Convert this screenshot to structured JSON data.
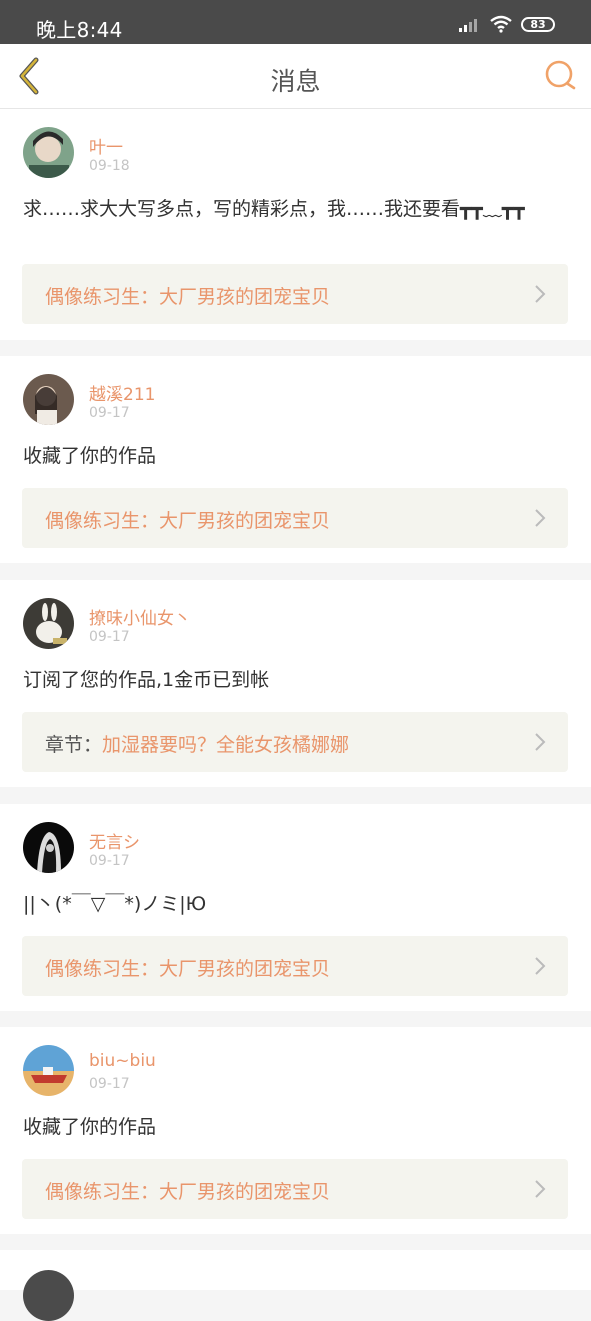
{
  "status_bar": {
    "time": "晚上8:44",
    "battery": "83"
  },
  "header": {
    "title": "消息",
    "back_icon": "chevron-left-icon",
    "search_icon": "search-icon",
    "accent_color": "#e9956b",
    "back_color": "#c9a227"
  },
  "messages": [
    {
      "user": "叶一",
      "date": "09-18",
      "text": "求……求大大写多点，写的精彩点，我……我还要看┳┳﹏┳┳",
      "link_prefix": "",
      "link": "偶像练习生：大厂男孩的团宠宝贝"
    },
    {
      "user": "越溪211",
      "date": "09-17",
      "text": "收藏了你的作品",
      "link_prefix": "",
      "link": "偶像练习生：大厂男孩的团宠宝贝"
    },
    {
      "user": "撩味小仙女丶",
      "date": "09-17",
      "text": "订阅了您的作品,1金币已到帐",
      "link_prefix": "章节：",
      "link": "加湿器要吗？全能女孩橘娜娜"
    },
    {
      "user": "无言シ",
      "date": "09-17",
      "text": "||丶(*￣▽￣*)ノミ|Ю",
      "link_prefix": "",
      "link": "偶像练习生：大厂男孩的团宠宝贝"
    },
    {
      "user": "biu~biu",
      "date": "09-17",
      "text": "收藏了你的作品",
      "link_prefix": "",
      "link": "偶像练习生：大厂男孩的团宠宝贝"
    }
  ]
}
